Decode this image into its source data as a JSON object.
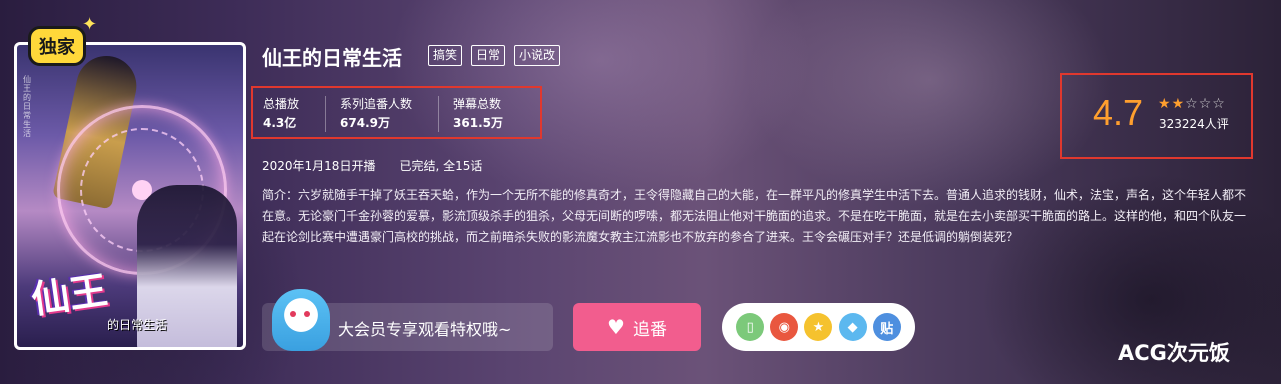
{
  "poster": {
    "badge": "独家",
    "logo_text": "仙王",
    "logo_sub": "的日常生活",
    "vertical_text": "仙王的日常生活"
  },
  "header": {
    "title": "仙王的日常生活",
    "tags": [
      "搞笑",
      "日常",
      "小说改"
    ]
  },
  "stats": [
    {
      "label": "总播放",
      "value": "4.3亿"
    },
    {
      "label": "系列追番人数",
      "value": "674.9万"
    },
    {
      "label": "弹幕总数",
      "value": "361.5万"
    }
  ],
  "rating": {
    "score": "4.7",
    "stars_filled": 2,
    "stars_total": 5,
    "count": "323224人评"
  },
  "meta": {
    "air_date": "2020年1月18日开播",
    "status": "已完结, 全15话"
  },
  "description": "简介：六岁就随手干掉了妖王吞天蛤，作为一个无所不能的修真奇才，王令得隐藏自己的大能，在一群平凡的修真学生中活下去。普通人追求的钱财，仙术，法宝，声名，这个年轻人都不在意。无论豪门千金孙蓉的爱慕，影流顶级杀手的狙杀，父母无间断的啰嗦，都无法阻止他对干脆面的追求。不是在吃干脆面，就是在去小卖部买干脆面的路上。这样的他，和四个队友一起在论剑比赛中遭遇豪门高校的挑战，而之前暗杀失败的影流魔女教主江流影也不放弃的参合了进来。王令会碾压对手？还是低调的躺倒装死？",
  "actions": {
    "vip_text": "大会员专享观看特权哦~",
    "follow_label": "追番",
    "share_icons": [
      {
        "name": "phone-icon",
        "glyph": "▯",
        "color": "#7cc97a"
      },
      {
        "name": "weibo-icon",
        "glyph": "◉",
        "color": "#e9573f"
      },
      {
        "name": "qzone-icon",
        "glyph": "★",
        "color": "#f5c22e"
      },
      {
        "name": "qq-icon",
        "glyph": "◆",
        "color": "#5cb8ef"
      },
      {
        "name": "tieba-icon",
        "glyph": "贴",
        "color": "#4e8fdf"
      }
    ]
  },
  "watermark": "ACG次元饭",
  "colors": {
    "accent_red_box": "#e0382e",
    "score": "#ff9f2e",
    "follow_button": "#f25d8e"
  }
}
